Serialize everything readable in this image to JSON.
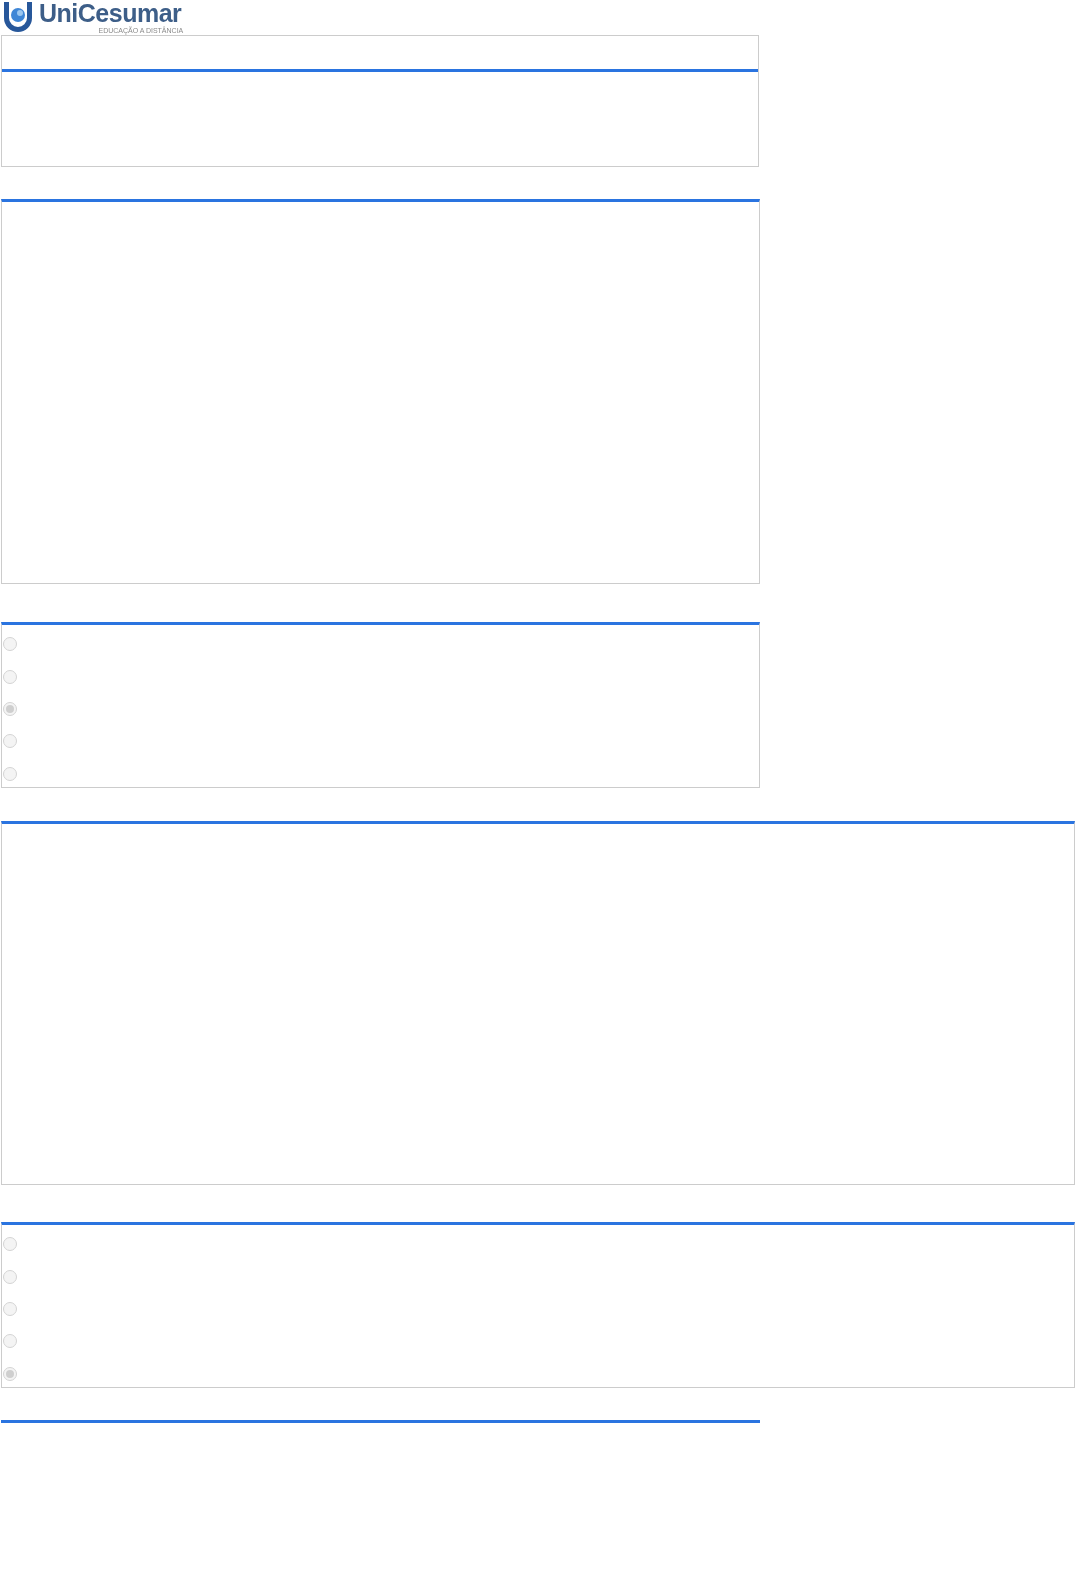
{
  "logo": {
    "name": "UniCesumar",
    "tagline": "EDUCAÇÃO A DISTÂNCIA"
  },
  "questions": [
    {
      "options": [
        {
          "selected": false,
          "disabled": true
        },
        {
          "selected": false,
          "disabled": true
        },
        {
          "selected": true,
          "disabled": true
        },
        {
          "selected": false,
          "disabled": true
        },
        {
          "selected": false,
          "disabled": true
        }
      ]
    },
    {
      "options": [
        {
          "selected": false,
          "disabled": true
        },
        {
          "selected": false,
          "disabled": true
        },
        {
          "selected": false,
          "disabled": true
        },
        {
          "selected": false,
          "disabled": true
        },
        {
          "selected": true,
          "disabled": true
        }
      ]
    }
  ]
}
